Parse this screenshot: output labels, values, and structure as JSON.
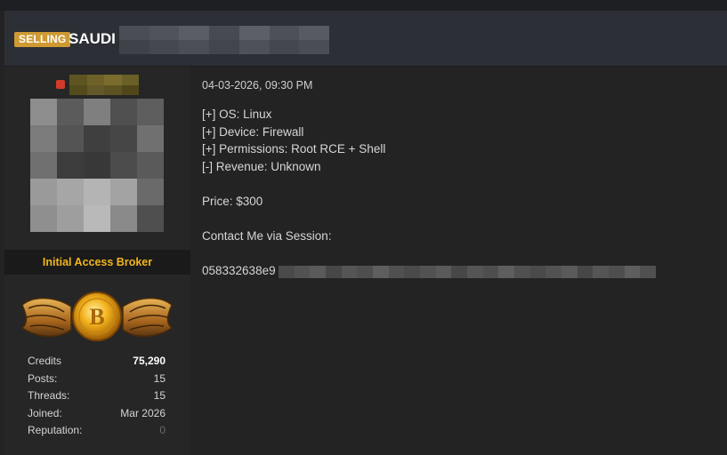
{
  "thread": {
    "badge": "SELLING",
    "title": "SAUDI"
  },
  "author": {
    "role": "Initial Access Broker",
    "award_icon": "bitcoin-emblem-icon",
    "stats": [
      {
        "label": "Credits",
        "value": "75,290"
      },
      {
        "label": "Posts:",
        "value": "15"
      },
      {
        "label": "Threads:",
        "value": "15"
      },
      {
        "label": "Joined:",
        "value": "Mar 2026"
      },
      {
        "label": "Reputation:",
        "value": "0"
      }
    ]
  },
  "post": {
    "date": "04-03-2026, 09:30 PM",
    "lines": [
      "[+] OS: Linux",
      "[+] Device: Firewall",
      "[+] Permissions: Root RCE + Shell",
      "[-] Revenue: Unknown"
    ],
    "price": "Price: $300",
    "contact_label": "Contact Me via Session:",
    "contact_value": "058332638e9"
  },
  "colors": {
    "badge": "#cf9a32",
    "role": "#f2b51d",
    "status_dot": "#d23b2a",
    "header_bg": "#2c2f35",
    "page_bg": "#232323"
  }
}
